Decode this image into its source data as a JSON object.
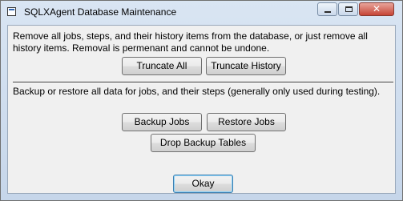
{
  "window": {
    "title": "SQLXAgent Database Maintenance",
    "icon": "application-icon",
    "close_glyph": "✕"
  },
  "truncate_section": {
    "description": "Remove all jobs, steps, and their history items from the database, or just remove all history items. Removal is permenant and cannot be undone.",
    "truncate_all_label": "Truncate All",
    "truncate_history_label": "Truncate History"
  },
  "backup_section": {
    "description": "Backup or restore all data for jobs, and their steps (generally only used during testing).",
    "backup_jobs_label": "Backup Jobs",
    "restore_jobs_label": "Restore Jobs",
    "drop_backup_tables_label": "Drop Backup Tables"
  },
  "footer": {
    "okay_label": "Okay"
  },
  "colors": {
    "title_bar": "#d9e5f3",
    "client_background": "#f0f0f0",
    "close_button": "#c64536"
  }
}
